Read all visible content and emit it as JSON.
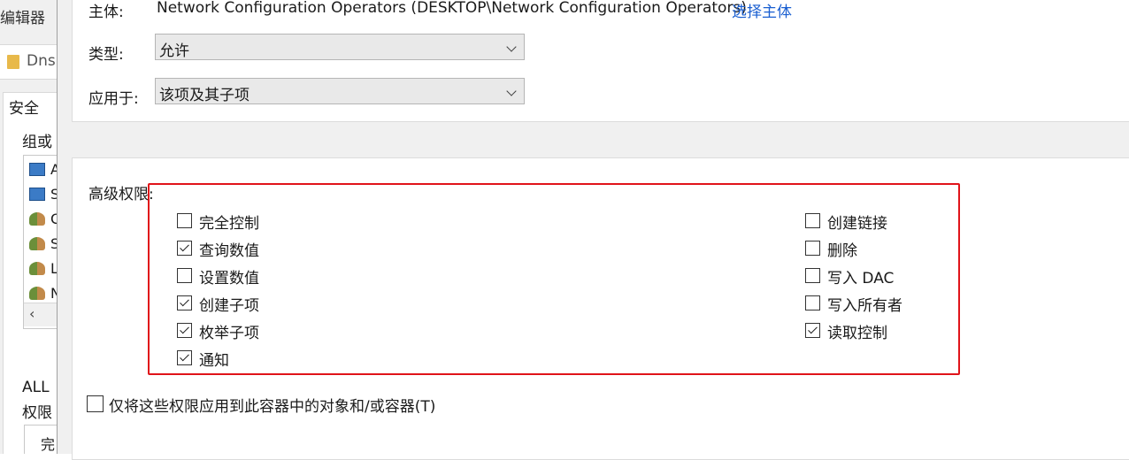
{
  "background_window": {
    "title": "编辑器",
    "path": "Dns",
    "tab": "安全",
    "group_label": "组或",
    "list_letters": [
      "A",
      "S",
      "C",
      "S",
      "L",
      "N"
    ],
    "all_label": "ALL",
    "perm_label": "权限",
    "box_text": "完"
  },
  "principal": {
    "label": "主体:",
    "value": "Network Configuration Operators (DESKTOP\\Network Configuration Operators)",
    "link": "选择主体"
  },
  "type": {
    "label": "类型:",
    "value": "允许"
  },
  "applies_to": {
    "label": "应用于:",
    "value": "该项及其子项"
  },
  "advanced": {
    "label": "高级权限:",
    "left": [
      {
        "label": "完全控制",
        "checked": false
      },
      {
        "label": "查询数值",
        "checked": true
      },
      {
        "label": "设置数值",
        "checked": false
      },
      {
        "label": "创建子项",
        "checked": true
      },
      {
        "label": "枚举子项",
        "checked": true
      },
      {
        "label": "通知",
        "checked": true
      }
    ],
    "right": [
      {
        "label": "创建链接",
        "checked": false
      },
      {
        "label": "删除",
        "checked": false
      },
      {
        "label": "写入 DAC",
        "checked": false
      },
      {
        "label": "写入所有者",
        "checked": false
      },
      {
        "label": "读取控制",
        "checked": true
      }
    ]
  },
  "apply_only": {
    "label": "仅将这些权限应用到此容器中的对象和/或容器(T)",
    "checked": false
  },
  "colors": {
    "link": "#1a5fd1",
    "highlight": "#e0141a"
  }
}
